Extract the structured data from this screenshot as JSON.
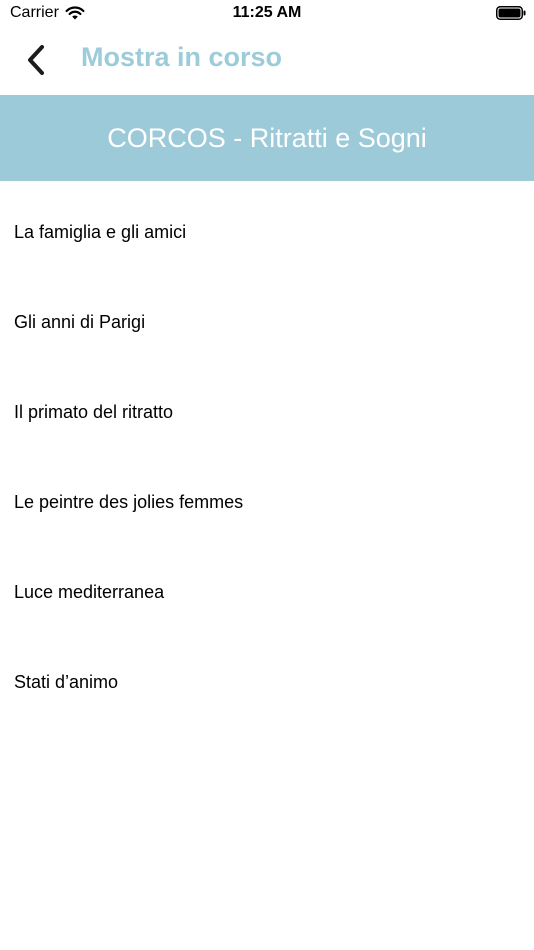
{
  "status_bar": {
    "carrier": "Carrier",
    "time": "11:25 AM"
  },
  "nav": {
    "back_icon": "chevron-left-icon",
    "title": "Mostra in corso",
    "title_color": "#9ccbd9"
  },
  "banner": {
    "title": "CORCOS - Ritratti e Sogni",
    "background": "#9dcad9"
  },
  "sections": [
    {
      "label": "La famiglia e gli amici"
    },
    {
      "label": "Gli anni di Parigi"
    },
    {
      "label": "Il primato del ritratto"
    },
    {
      "label": "Le peintre des jolies femmes"
    },
    {
      "label": "Luce mediterranea"
    },
    {
      "label": "Stati d’animo"
    }
  ]
}
